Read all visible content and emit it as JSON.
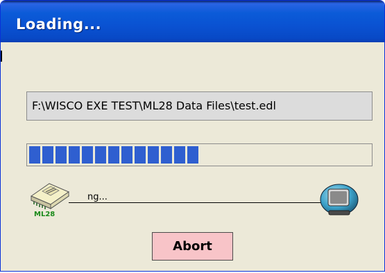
{
  "window": {
    "title": "Loading..."
  },
  "file_path": "F:\\WISCO EXE TEST\\ML28 Data Files\\test.edl",
  "progress": {
    "filled_blocks": 13,
    "accent": "#2f5fd0"
  },
  "transfer": {
    "device_icon": "device-module-icon",
    "device_label": "ML28",
    "status_text": "ng...",
    "computer_icon": "computer-monitor-icon"
  },
  "buttons": {
    "abort_label": "Abort"
  },
  "colors": {
    "titlebar": "#0a52d2",
    "dialog_bg": "#ece9d8",
    "abort_bg": "#f8c4c8"
  }
}
